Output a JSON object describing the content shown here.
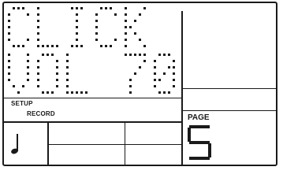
{
  "display": {
    "line1": "CLICK",
    "line2": "VOL 70",
    "setup_label": "SETUP",
    "record_label": "RECORD",
    "page_label": "PAGE",
    "page_number": "5",
    "note_icon": "quarter-note-icon"
  }
}
